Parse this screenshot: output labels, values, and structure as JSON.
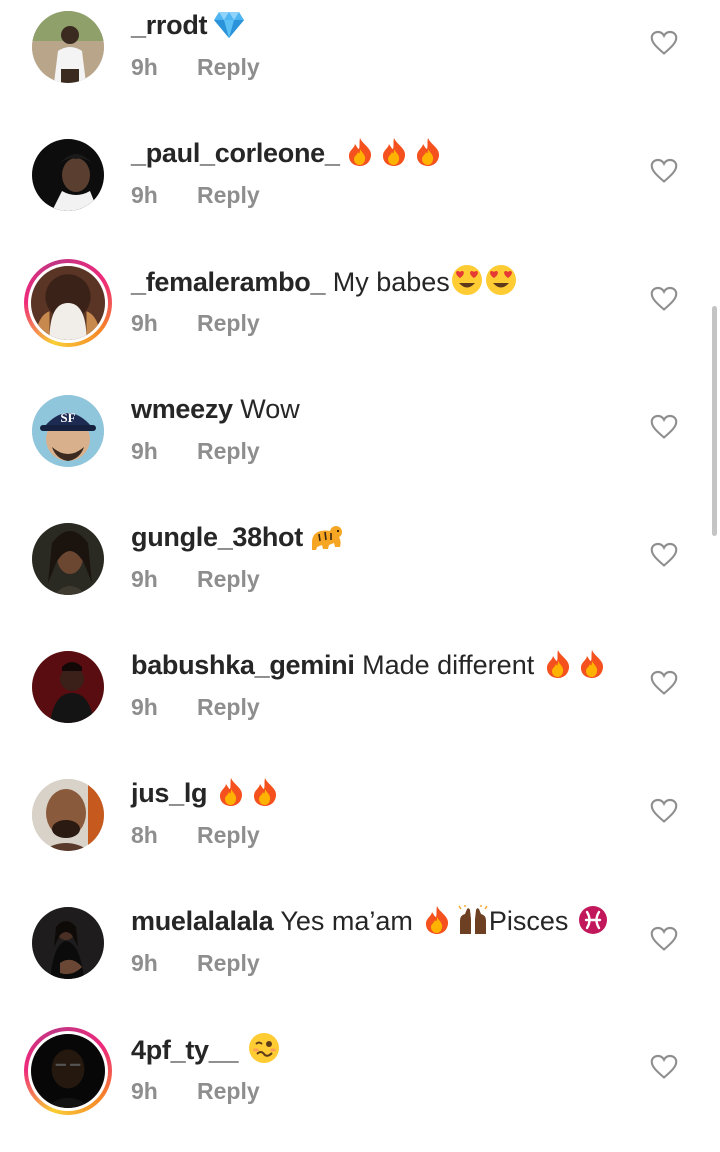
{
  "comments": [
    {
      "username": "_rrodt",
      "text": "",
      "emojis": [
        "gem"
      ],
      "time": "9h",
      "reply": "Reply",
      "story": false,
      "avatar": "person-white-shirt"
    },
    {
      "username": "_paul_corleone_",
      "text": "",
      "emojis": [
        "fire",
        "fire",
        "fire"
      ],
      "time": "9h",
      "reply": "Reply",
      "story": false,
      "avatar": "person-portrait"
    },
    {
      "username": "_femalerambo_",
      "text": "My babes",
      "emojis": [
        "heart-eyes",
        "heart-eyes"
      ],
      "time": "9h",
      "reply": "Reply",
      "story": true,
      "avatar": "person-back"
    },
    {
      "username": "wmeezy",
      "text": "Wow",
      "emojis": [],
      "time": "9h",
      "reply": "Reply",
      "story": false,
      "avatar": "cartoon-cap"
    },
    {
      "username": "gungle_38hot",
      "text": "",
      "emojis": [
        "tiger"
      ],
      "time": "9h",
      "reply": "Reply",
      "story": false,
      "avatar": "person-dreads"
    },
    {
      "username": "babushka_gemini",
      "text": "Made different",
      "emojis": [
        "fire",
        "fire"
      ],
      "time": "9h",
      "reply": "Reply",
      "story": false,
      "avatar": "person-red"
    },
    {
      "username": "jus_lg",
      "text": "",
      "emojis": [
        "fire",
        "fire"
      ],
      "time": "8h",
      "reply": "Reply",
      "story": false,
      "avatar": "person-selfie"
    },
    {
      "username": "muelalalala",
      "text": "Yes ma’am",
      "emojis": [
        "fire",
        "raised-hands"
      ],
      "text2": "Pisces",
      "emojis2": [
        "pisces"
      ],
      "time": "9h",
      "reply": "Reply",
      "story": false,
      "avatar": "person-dark"
    },
    {
      "username": "4pf_ty__",
      "text": "",
      "emojis": [
        "woozy"
      ],
      "time": "9h",
      "reply": "Reply",
      "story": true,
      "avatar": "person-dark2"
    }
  ],
  "icons": {
    "like": "heart-outline-icon"
  }
}
